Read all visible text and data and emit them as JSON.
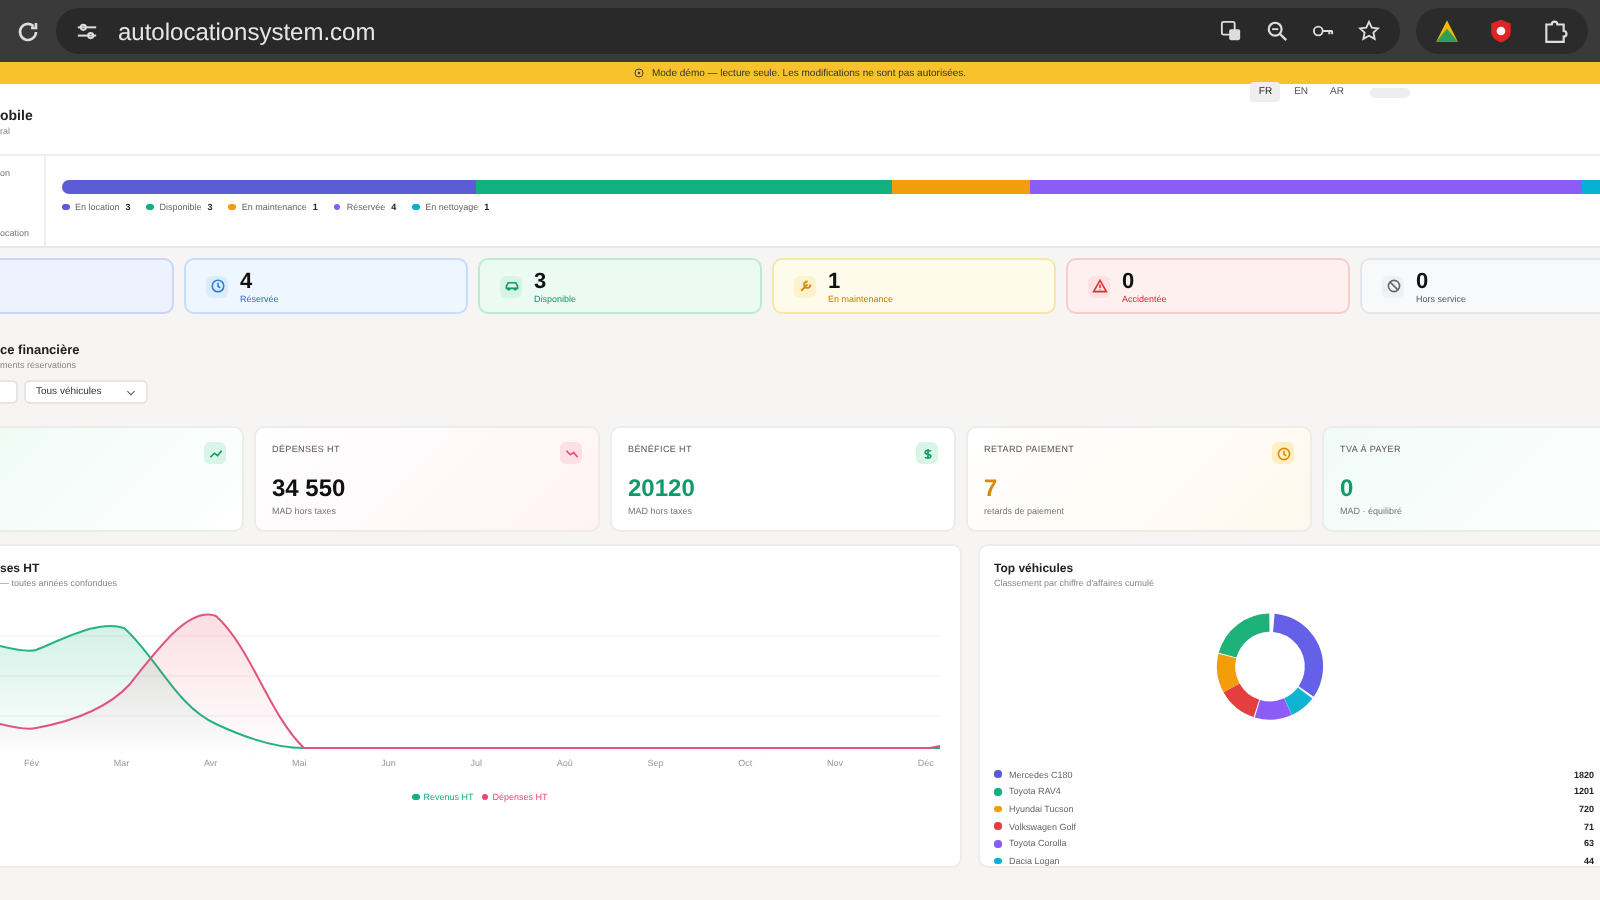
{
  "browser": {
    "url": "autolocationsystem.com"
  },
  "banner": {
    "text": "Mode démo — lecture seule. Les modifications ne sont pas autorisées."
  },
  "header": {
    "title": "obile",
    "subtitle": "ral",
    "languages": [
      {
        "label": "FR",
        "selected": true
      },
      {
        "label": "EN",
        "selected": false
      },
      {
        "label": "AR",
        "selected": false
      }
    ]
  },
  "fleet": {
    "labels": [
      "on",
      "ocation"
    ],
    "statuses": [
      {
        "label": "En location",
        "count": "3",
        "color": "#5b5bd6"
      },
      {
        "label": "Disponible",
        "count": "3",
        "color": "#10b07f"
      },
      {
        "label": "En maintenance",
        "count": "1",
        "color": "#f29d0b"
      },
      {
        "label": "Réservée",
        "count": "4",
        "color": "#8b5cf6"
      },
      {
        "label": "En nettoyage",
        "count": "1",
        "color": "#06b0d0"
      }
    ]
  },
  "status_cards": [
    {
      "kind": "blank"
    },
    {
      "kind": "reserved",
      "value": "4",
      "label": "Réservée"
    },
    {
      "kind": "available",
      "value": "3",
      "label": "Disponible"
    },
    {
      "kind": "maintenance",
      "value": "1",
      "label": "En maintenance"
    },
    {
      "kind": "accident",
      "value": "0",
      "label": "Accidentée"
    },
    {
      "kind": "off",
      "value": "0",
      "label": "Hors service"
    }
  ],
  "finance": {
    "title": "ce financière",
    "subtitle": "ments réservations",
    "filter": "Tous véhicules"
  },
  "kpis": [
    {
      "kind": "revenue"
    },
    {
      "kind": "expense",
      "label": "DÉPENSES HT",
      "value": "34 550",
      "note": "MAD hors taxes"
    },
    {
      "kind": "profit",
      "label": "BÉNÉFICE HT",
      "value": "20120",
      "note": "MAD hors taxes"
    },
    {
      "kind": "late",
      "label": "RETARD PAIEMENT",
      "value": "7",
      "note": "retards de paiement"
    },
    {
      "kind": "vat",
      "label": "TVA À PAYER",
      "value": "0",
      "note": "MAD · équilibré"
    }
  ],
  "revenue_chart": {
    "title": "ses HT",
    "subtitle": "— toutes années confondues",
    "months": [
      "Fév",
      "Mar",
      "Avr",
      "Mai",
      "Jun",
      "Jul",
      "Aoû",
      "Sep",
      "Oct",
      "Nov",
      "Déc"
    ],
    "legend": [
      {
        "label": "Revenus HT",
        "color": "#10b07f"
      },
      {
        "label": "Dépenses HT",
        "color": "#e8486e"
      }
    ]
  },
  "top_vehicles": {
    "title": "Top véhicules",
    "subtitle": "Classement par chiffre d'affaires cumulé",
    "items": [
      {
        "name": "Mercedes C180",
        "value": "1820",
        "color": "#5b5bd6"
      },
      {
        "name": "Toyota RAV4",
        "value": "1201",
        "color": "#10b07f"
      },
      {
        "name": "Hyundai Tucson",
        "value": "720",
        "color": "#f29d0b"
      },
      {
        "name": "Volkswagen Golf",
        "value": "71",
        "color": "#e53e3e"
      },
      {
        "name": "Toyota Corolla",
        "value": "63",
        "color": "#8b5cf6"
      },
      {
        "name": "Dacia Logan",
        "value": "44",
        "color": "#06b0d0"
      }
    ]
  }
}
